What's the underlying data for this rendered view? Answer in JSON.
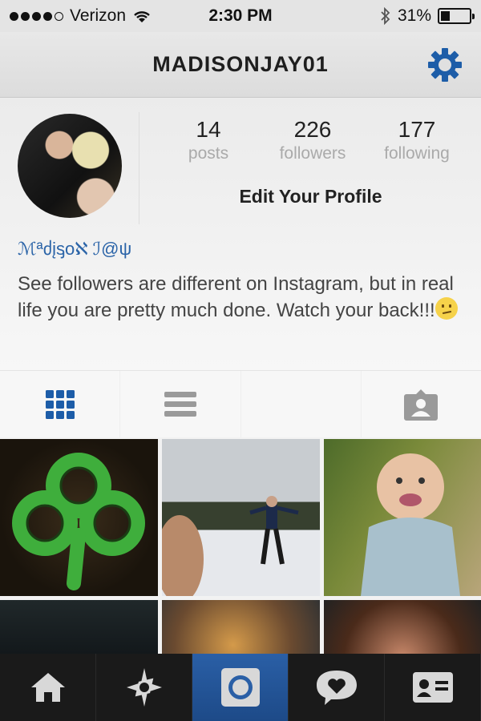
{
  "status_bar": {
    "carrier": "Verizon",
    "time": "2:30 PM",
    "battery": "31%",
    "battery_level": 0.31,
    "signal_dots_filled": 4,
    "signal_dots_total": 5,
    "icons": [
      "wifi-icon",
      "bluetooth-icon",
      "battery-icon"
    ]
  },
  "nav": {
    "title": "MADISONJAY01",
    "settings_icon": "gear-icon",
    "accent": "#1d5da8"
  },
  "profile": {
    "stats": [
      {
        "num": "14",
        "label": "posts"
      },
      {
        "num": "226",
        "label": "followers"
      },
      {
        "num": "177",
        "label": "following"
      }
    ],
    "edit_label": "Edit Your Profile",
    "display_name": "ℳªძįᶊoℵ ℐ@ψ",
    "bio": "See followers are different on Instagram, but in real life you are pretty much done. Watch your back!!!",
    "bio_emoji": "confused-face-icon"
  },
  "view_tabs": [
    {
      "icon": "grid-icon",
      "selected": true
    },
    {
      "icon": "list-icon",
      "selected": false
    },
    {
      "icon": "map-icon",
      "selected": false
    },
    {
      "icon": "tagged-photos-icon",
      "selected": false
    }
  ],
  "bottom_tabs": [
    {
      "icon": "home-icon",
      "selected": false
    },
    {
      "icon": "explore-icon",
      "selected": false
    },
    {
      "icon": "camera-icon",
      "selected": true
    },
    {
      "icon": "activity-icon",
      "selected": false
    },
    {
      "icon": "profile-icon",
      "selected": false
    }
  ],
  "colors": {
    "link_blue": "#2b64a8",
    "icon_blue": "#1d5da8",
    "tab_active": "#2a5fa6",
    "bottom_bar": "#1a1a1a"
  }
}
